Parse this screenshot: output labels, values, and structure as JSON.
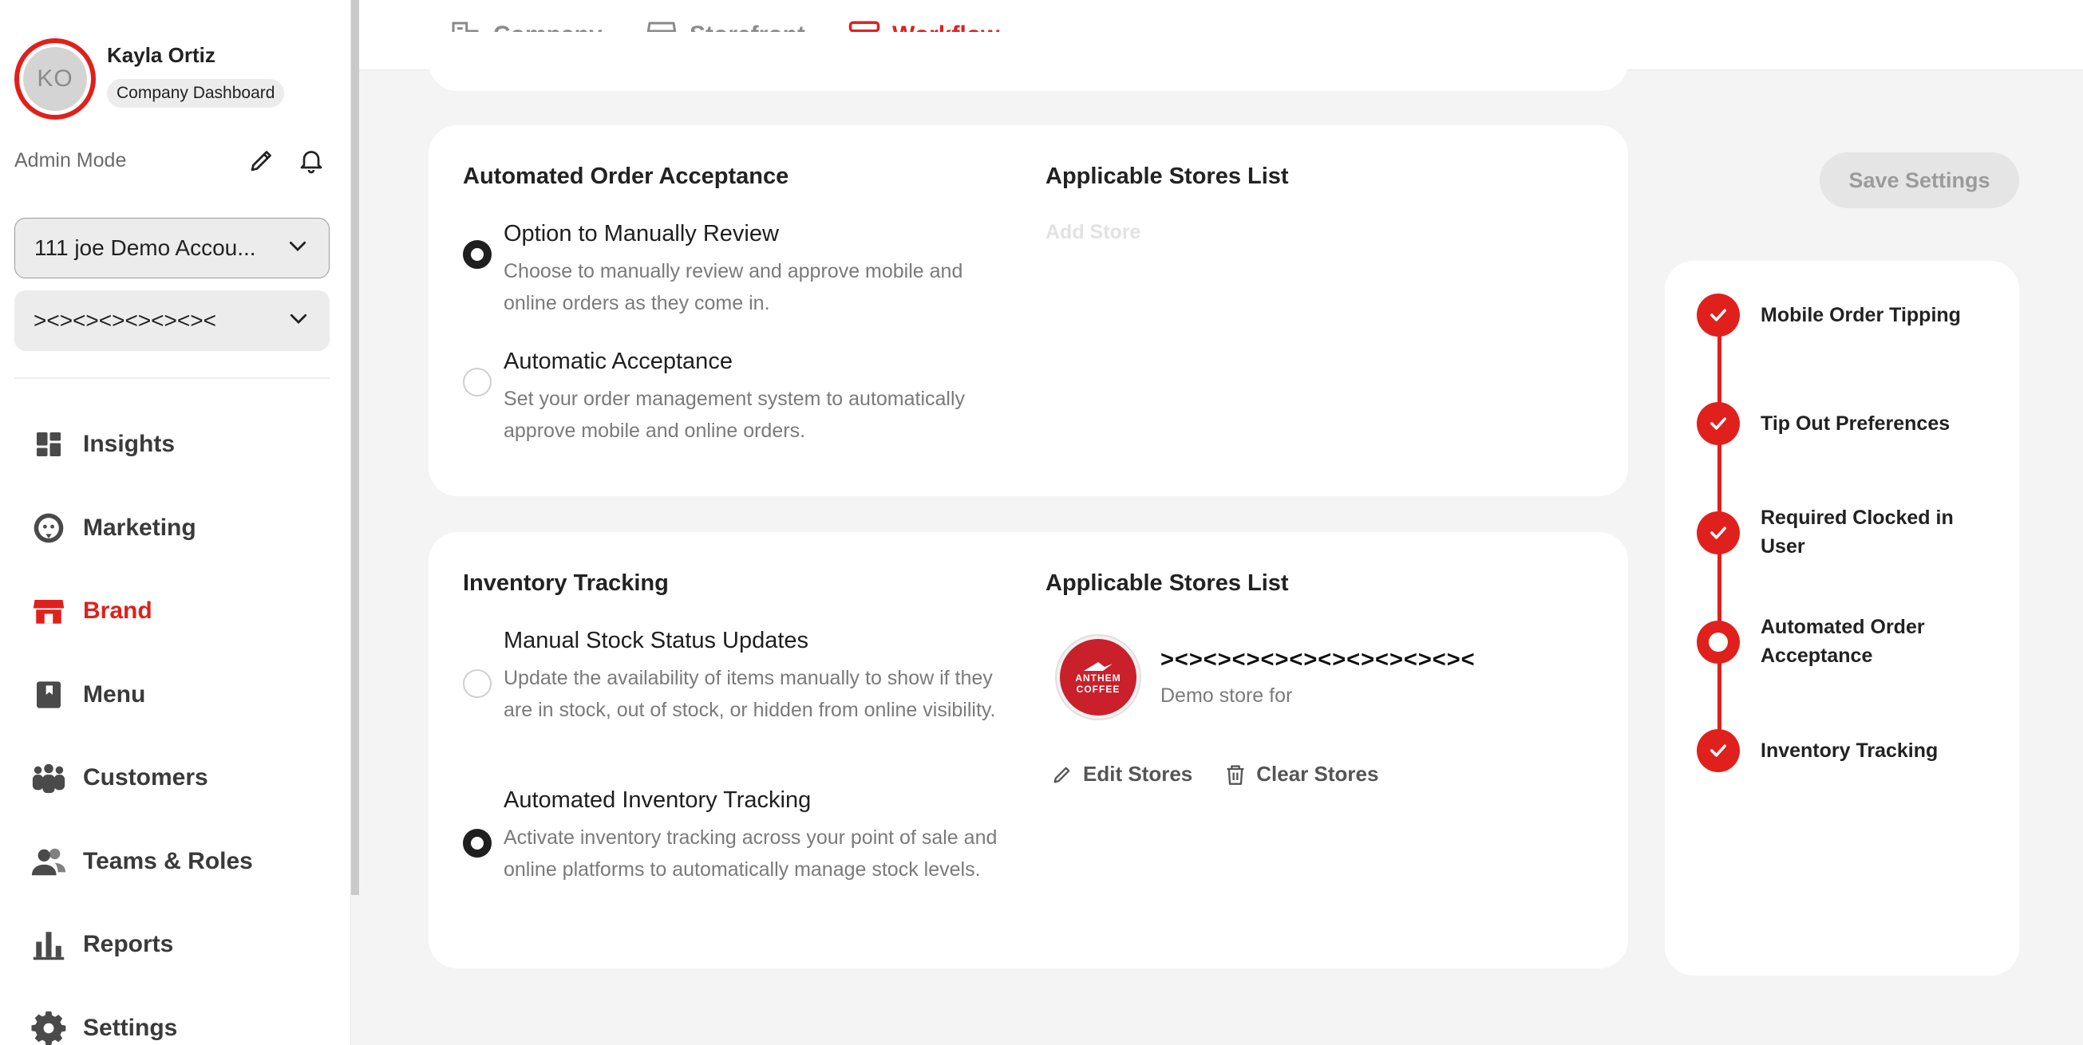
{
  "profile": {
    "initials": "KO",
    "name": "Kayla Ortiz",
    "role": "Company Dashboard"
  },
  "admin": {
    "label": "Admin Mode"
  },
  "selects": {
    "account": "111 joe Demo Accou...",
    "store": "><><><><><><><"
  },
  "nav": [
    {
      "label": "Insights",
      "icon": "dashboard-icon"
    },
    {
      "label": "Marketing",
      "icon": "marketing-icon"
    },
    {
      "label": "Brand",
      "icon": "storefront-icon"
    },
    {
      "label": "Menu",
      "icon": "menu-book-icon"
    },
    {
      "label": "Customers",
      "icon": "customers-icon"
    },
    {
      "label": "Teams & Roles",
      "icon": "teams-icon"
    },
    {
      "label": "Reports",
      "icon": "reports-icon"
    },
    {
      "label": "Settings",
      "icon": "gear-icon"
    }
  ],
  "tabs": [
    {
      "label": "Company",
      "icon": "building-icon"
    },
    {
      "label": "Storefront",
      "icon": "storefront-icon"
    },
    {
      "label": "Workflow",
      "icon": "workflow-icon"
    }
  ],
  "order_acceptance": {
    "title": "Automated Order Acceptance",
    "stores_title": "Applicable Stores List",
    "add_store": "Add Store",
    "options": [
      {
        "title": "Option to Manually Review",
        "desc": "Choose to manually review and approve mobile and online orders as they come in.",
        "selected": true
      },
      {
        "title": "Automatic Acceptance",
        "desc": "Set your order management system to automatically approve mobile and online orders.",
        "selected": false
      }
    ]
  },
  "inventory": {
    "title": "Inventory Tracking",
    "stores_title": "Applicable Stores List",
    "options": [
      {
        "title": "Manual Stock Status Updates",
        "desc": "Update the availability of items manually to show if they are in stock, out of stock, or hidden from online visibility.",
        "selected": false
      },
      {
        "title": "Automated Inventory Tracking",
        "desc": "Activate inventory tracking across your point of sale and online platforms to automatically manage stock levels.",
        "selected": true
      }
    ],
    "store": {
      "name": "><><><><><><><><><><><",
      "desc": "Demo store for",
      "logo_top": "ANTHEM",
      "logo_bottom": "COFFEE"
    },
    "edit_label": "Edit Stores",
    "clear_label": "Clear Stores"
  },
  "save_label": "Save Settings",
  "steps": [
    {
      "label": "Mobile Order Tipping",
      "state": "done"
    },
    {
      "label": "Tip Out Preferences",
      "state": "done"
    },
    {
      "label": "Required Clocked in User",
      "state": "done"
    },
    {
      "label": "Automated Order Acceptance",
      "state": "current"
    },
    {
      "label": "Inventory Tracking",
      "state": "done"
    }
  ],
  "colors": {
    "accent": "#e0201c",
    "background": "#f4f4f4",
    "logo": "#c9202b"
  }
}
